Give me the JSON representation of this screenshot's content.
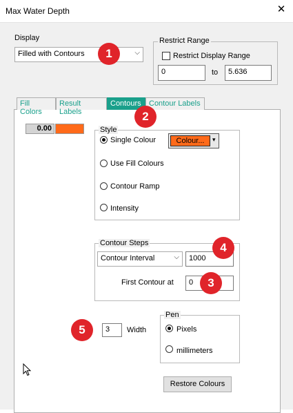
{
  "window": {
    "title": "Max Water Depth",
    "close_glyph": "✕"
  },
  "display": {
    "label": "Display",
    "selected": "Filled with Contours"
  },
  "restrict": {
    "group_label": "Restrict Range",
    "checkbox_label": "Restrict Display Range",
    "checked": false,
    "min": "0",
    "to_label": "to",
    "max": "5.636"
  },
  "tabs": [
    "Fill Colors",
    "Result Labels",
    "Contours",
    "Contour Labels"
  ],
  "active_tab": 2,
  "swatch": {
    "value": "0.00",
    "color": "#ff6a1a"
  },
  "style": {
    "group_label": "Style",
    "options": [
      "Single Colour",
      "Use Fill Colours",
      "Contour Ramp",
      "Intensity"
    ],
    "selected": 0,
    "colour_button": "Colour..."
  },
  "steps": {
    "group_label": "Contour Steps",
    "mode": "Contour Interval",
    "interval": "1000",
    "first_label": "First Contour at",
    "first_value": "0"
  },
  "width": {
    "value": "3",
    "label": "Width"
  },
  "pen": {
    "group_label": "Pen",
    "options": [
      "Pixels",
      "millimeters"
    ],
    "selected": 0
  },
  "restore_button": "Restore  Colours",
  "callouts": [
    "1",
    "2",
    "3",
    "4",
    "5"
  ],
  "colors": {
    "accent": "#1aa08b",
    "badge": "#e0242a",
    "orange": "#ff6a1a"
  }
}
